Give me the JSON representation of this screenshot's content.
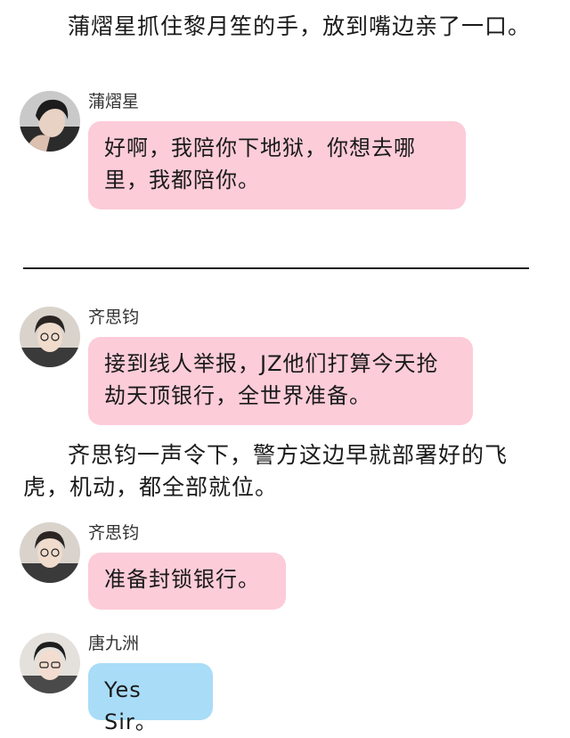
{
  "narration_1": "蒲熠星抓住黎月笙的手，放到嘴边亲了一口。",
  "msg_1": {
    "sender": "蒲熠星",
    "text": "好啊，我陪你下地狱，你想去哪里，我都陪你。",
    "avatar_icon": "avatar-puyixing-icon",
    "bubble_color": "#fcccd9"
  },
  "separator": "————————————————————",
  "msg_2": {
    "sender": "齐思钧",
    "text": "接到线人举报，JZ他们打算今天抢劫天顶银行，全世界准备。",
    "avatar_icon": "avatar-qisijun-icon",
    "bubble_color": "#fcccd9"
  },
  "narration_2": "齐思钧一声令下，警方这边早就部署好的飞虎，机动，都全部就位。",
  "msg_3": {
    "sender": "齐思钧",
    "text": "准备封锁银行。",
    "avatar_icon": "avatar-qisijun-icon",
    "bubble_color": "#fcccd9"
  },
  "msg_4": {
    "sender": "唐九洲",
    "text": "Yes Sir。",
    "avatar_icon": "avatar-tangjiuzhou-icon",
    "bubble_color": "#a9dcf7"
  }
}
